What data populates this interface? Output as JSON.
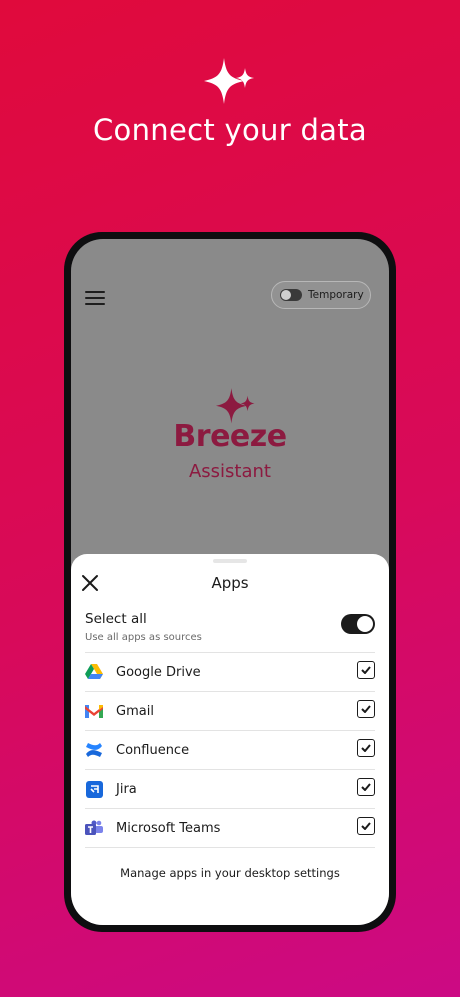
{
  "hero": {
    "title": "Connect your data",
    "icon": "sparkle-icon"
  },
  "phone_screen": {
    "menu_icon": "hamburger-menu-icon",
    "temporary_label": "Temporary",
    "brand": {
      "name": "Breeze",
      "subtitle": "Assistant",
      "color": "#8c1a40"
    }
  },
  "apps_sheet": {
    "title": "Apps",
    "close_icon": "close-icon",
    "select_all": {
      "label": "Select all",
      "description": "Use all apps as sources",
      "enabled": true
    },
    "apps": [
      {
        "name": "Google Drive",
        "icon": "google-drive-icon",
        "checked": true
      },
      {
        "name": "Gmail",
        "icon": "gmail-icon",
        "checked": true
      },
      {
        "name": "Confluence",
        "icon": "confluence-icon",
        "checked": true
      },
      {
        "name": "Jira",
        "icon": "jira-icon",
        "checked": true
      },
      {
        "name": "Microsoft Teams",
        "icon": "microsoft-teams-icon",
        "checked": true
      }
    ],
    "footer": "Manage apps in your desktop settings"
  },
  "colors": {
    "background_start": "#e00a3c",
    "background_end": "#cc0a84",
    "accent": "#8c1a40"
  }
}
